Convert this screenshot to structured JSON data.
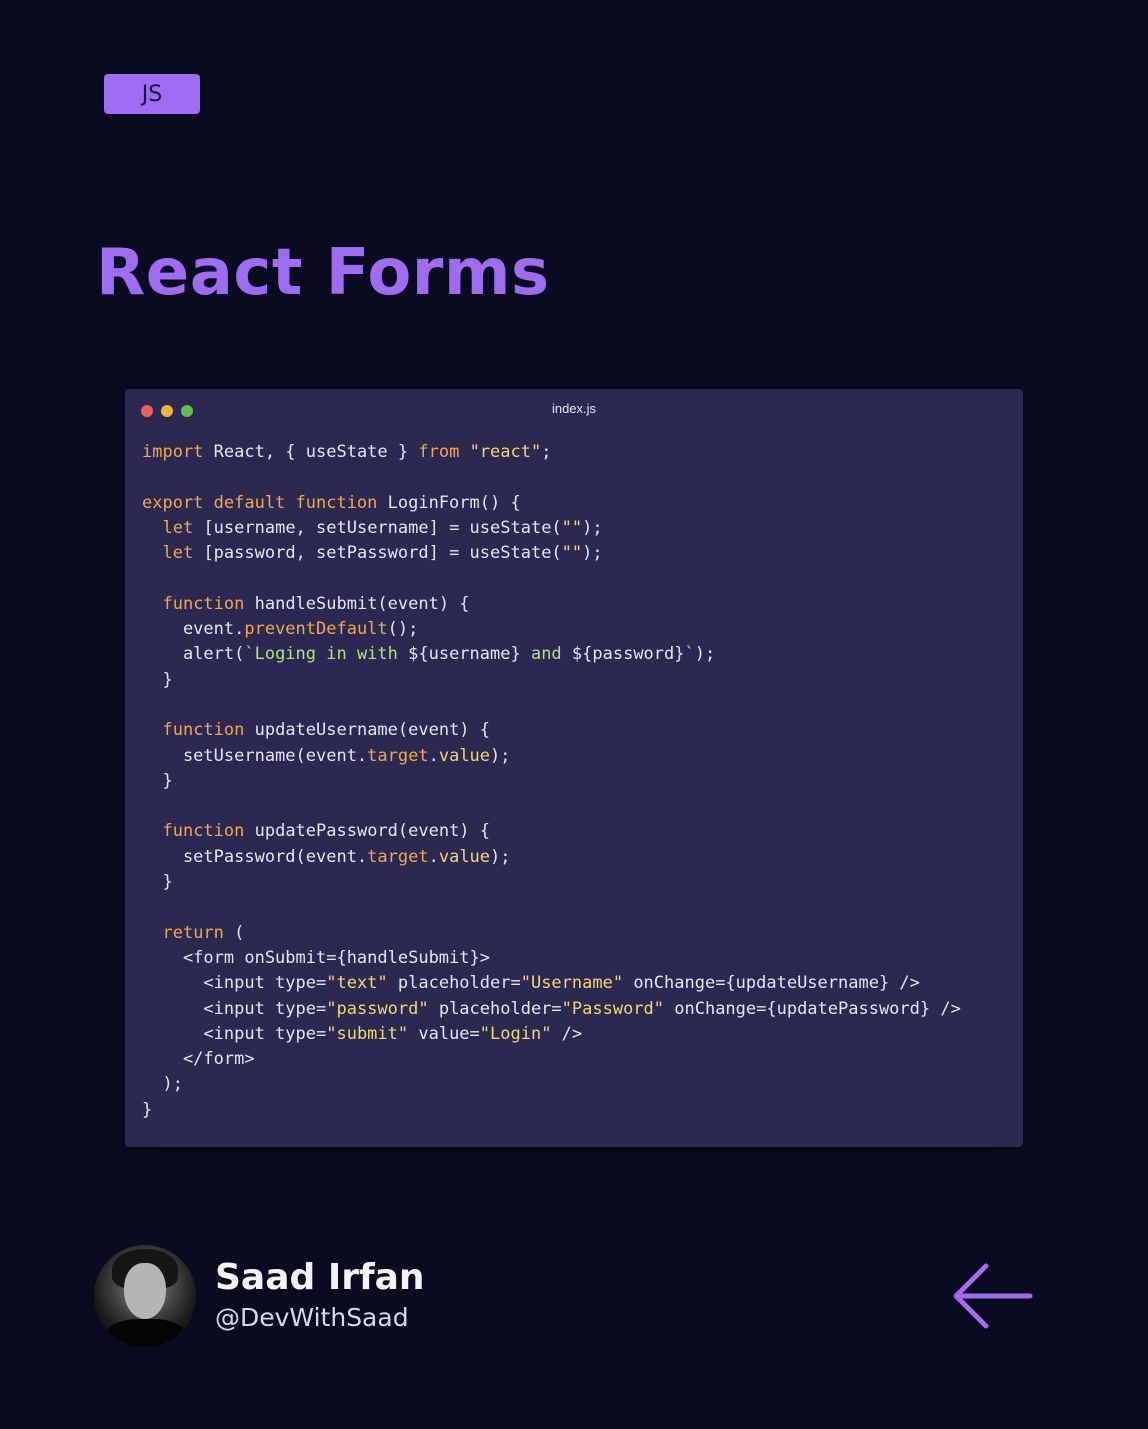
{
  "tag": {
    "label": "JS"
  },
  "title": "React Forms",
  "editor": {
    "filename": "index.js",
    "window_dots": [
      "#ec5f5a",
      "#e8b73c",
      "#5ec14b"
    ],
    "code_lines": [
      [
        [
          "kw",
          "import"
        ],
        [
          "plain",
          " React, { useState } "
        ],
        [
          "kw",
          "from"
        ],
        [
          "plain",
          " "
        ],
        [
          "str",
          "\"react\""
        ],
        [
          "plain",
          ";"
        ]
      ],
      [],
      [
        [
          "kw",
          "export default function"
        ],
        [
          "plain",
          " LoginForm() {"
        ]
      ],
      [
        [
          "plain",
          "  "
        ],
        [
          "kw",
          "let"
        ],
        [
          "plain",
          " [username, setUsername] = useState("
        ],
        [
          "str",
          "\"\""
        ],
        [
          "plain",
          ");"
        ]
      ],
      [
        [
          "plain",
          "  "
        ],
        [
          "kw",
          "let"
        ],
        [
          "plain",
          " [password, setPassword] = useState("
        ],
        [
          "str",
          "\"\""
        ],
        [
          "plain",
          ");"
        ]
      ],
      [],
      [
        [
          "plain",
          "  "
        ],
        [
          "kw",
          "function"
        ],
        [
          "plain",
          " handleSubmit(event) {"
        ]
      ],
      [
        [
          "plain",
          "    event."
        ],
        [
          "prop",
          "preventDefault"
        ],
        [
          "plain",
          "();"
        ]
      ],
      [
        [
          "plain",
          "    alert("
        ],
        [
          "tpl",
          "`Loging in with "
        ],
        [
          "plain",
          "${username}"
        ],
        [
          "tpl",
          " and "
        ],
        [
          "plain",
          "${password}"
        ],
        [
          "tpl",
          "`"
        ],
        [
          "plain",
          ");"
        ]
      ],
      [
        [
          "plain",
          "  }"
        ]
      ],
      [],
      [
        [
          "plain",
          "  "
        ],
        [
          "kw",
          "function"
        ],
        [
          "plain",
          " updateUsername(event) {"
        ]
      ],
      [
        [
          "plain",
          "    setUsername(event."
        ],
        [
          "prop",
          "target"
        ],
        [
          "plain",
          "."
        ],
        [
          "str",
          "value"
        ],
        [
          "plain",
          ");"
        ]
      ],
      [
        [
          "plain",
          "  }"
        ]
      ],
      [],
      [
        [
          "plain",
          "  "
        ],
        [
          "kw",
          "function"
        ],
        [
          "plain",
          " updatePassword(event) {"
        ]
      ],
      [
        [
          "plain",
          "    setPassword(event."
        ],
        [
          "prop",
          "target"
        ],
        [
          "plain",
          "."
        ],
        [
          "str",
          "value"
        ],
        [
          "plain",
          ");"
        ]
      ],
      [
        [
          "plain",
          "  }"
        ]
      ],
      [],
      [
        [
          "plain",
          "  "
        ],
        [
          "kw",
          "return"
        ],
        [
          "plain",
          " ("
        ]
      ],
      [
        [
          "plain",
          "    <form onSubmit={handleSubmit}>"
        ]
      ],
      [
        [
          "plain",
          "      <input type="
        ],
        [
          "str",
          "\"text\""
        ],
        [
          "plain",
          " placeholder="
        ],
        [
          "str",
          "\"Username\""
        ],
        [
          "plain",
          " onChange={updateUsername} />"
        ]
      ],
      [
        [
          "plain",
          "      <input type="
        ],
        [
          "str",
          "\"password\""
        ],
        [
          "plain",
          " placeholder="
        ],
        [
          "str",
          "\"Password\""
        ],
        [
          "plain",
          " onChange={updatePassword} />"
        ]
      ],
      [
        [
          "plain",
          "      <input type="
        ],
        [
          "str",
          "\"submit\""
        ],
        [
          "plain",
          " value="
        ],
        [
          "str",
          "\"Login\""
        ],
        [
          "plain",
          " />"
        ]
      ],
      [
        [
          "plain",
          "    </form>"
        ]
      ],
      [
        [
          "plain",
          "  );"
        ]
      ],
      [
        [
          "plain",
          "}"
        ]
      ]
    ]
  },
  "author": {
    "name": "Saad Irfan",
    "handle": "@DevWithSaad"
  },
  "nav": {
    "icon": "arrow-left-icon",
    "color": "#9d6cf0"
  }
}
